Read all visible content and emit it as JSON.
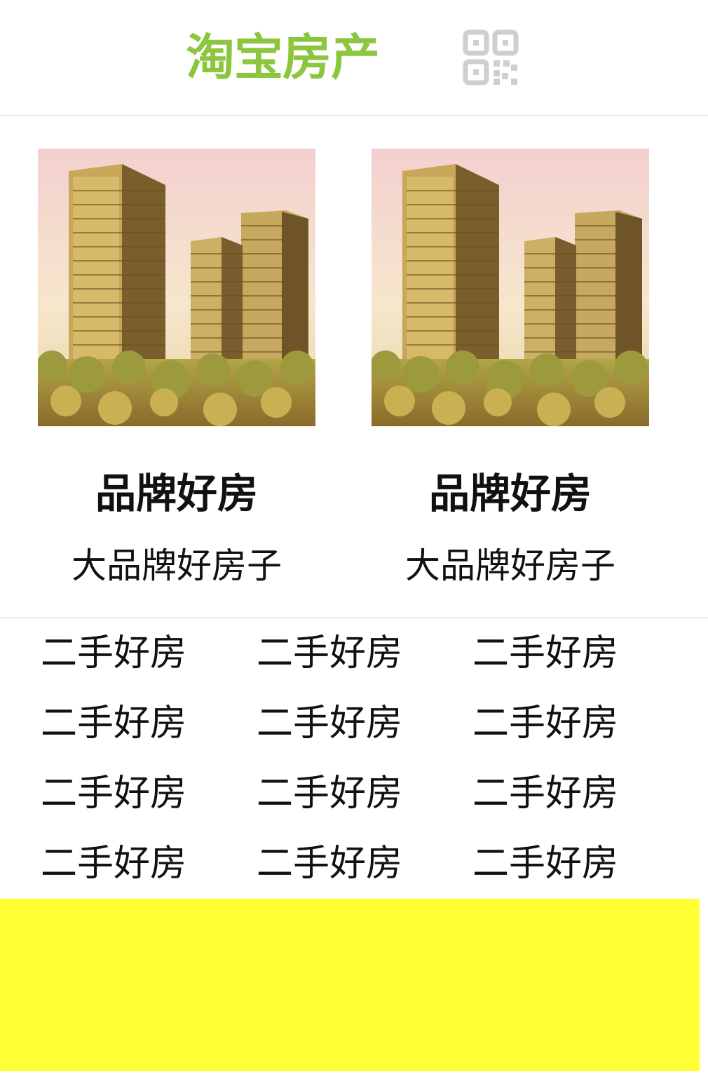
{
  "header": {
    "logo_text": "淘宝房产",
    "logo_color": "#8cc63e",
    "qr_icon": "qr-code-icon"
  },
  "cards": [
    {
      "title": "品牌好房",
      "subtitle": "大品牌好房子",
      "image": "building-photo"
    },
    {
      "title": "品牌好房",
      "subtitle": "大品牌好房子",
      "image": "building-photo"
    }
  ],
  "links": [
    "二手好房",
    "二手好房",
    "二手好房",
    "二手好房",
    "二手好房",
    "二手好房",
    "二手好房",
    "二手好房",
    "二手好房",
    "二手好房",
    "二手好房",
    "二手好房"
  ],
  "footer": {
    "background": "#ffff33"
  }
}
